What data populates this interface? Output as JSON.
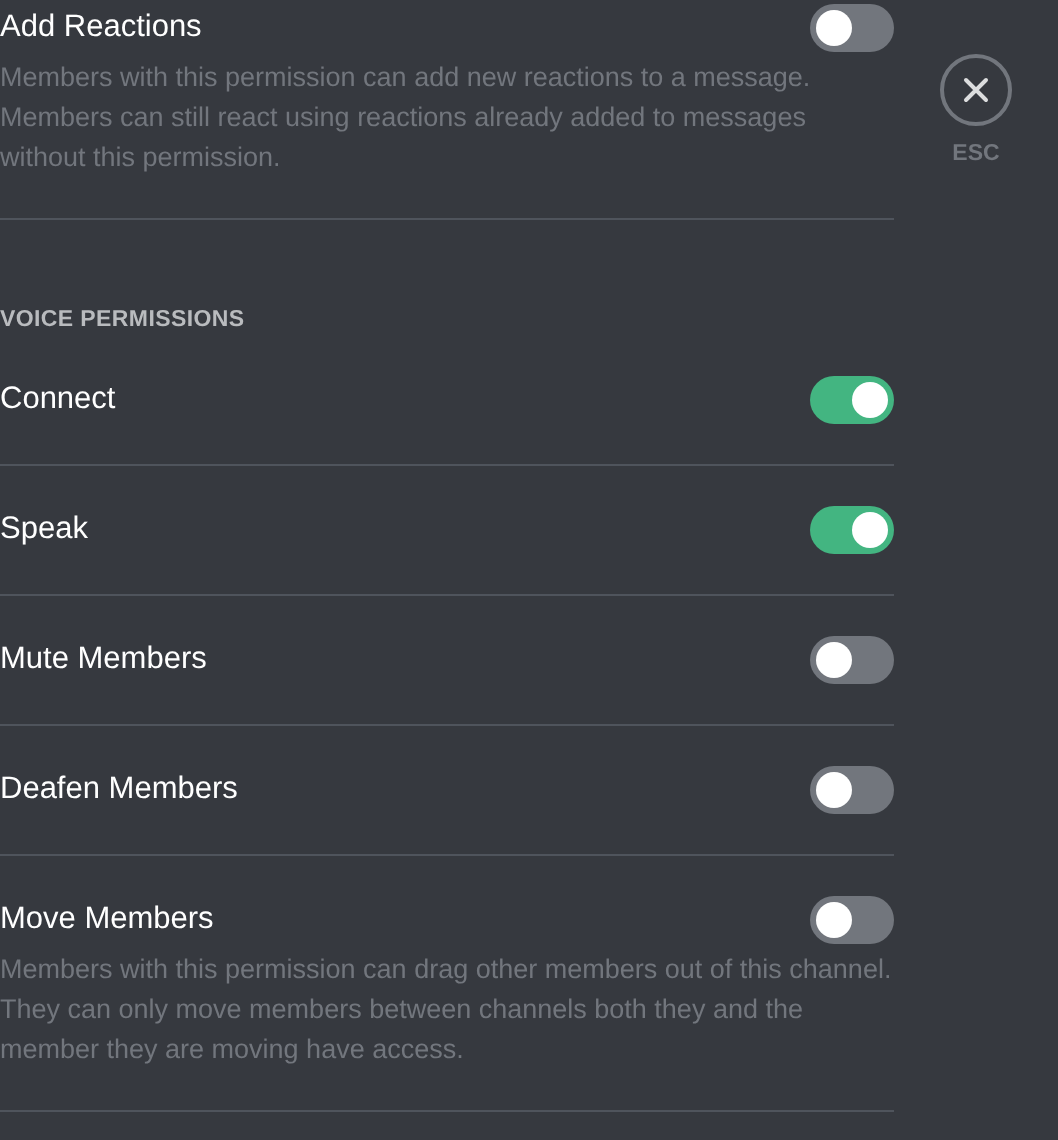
{
  "sections": [
    {
      "items": [
        {
          "title": "Add Reactions",
          "description": "Members with this permission can add new reactions to a message. Members can still react using reactions already added to messages without this permission.",
          "on": false
        }
      ]
    },
    {
      "header": "VOICE PERMISSIONS",
      "items": [
        {
          "title": "Connect",
          "on": true
        },
        {
          "title": "Speak",
          "on": true
        },
        {
          "title": "Mute Members",
          "on": false
        },
        {
          "title": "Deafen Members",
          "on": false
        },
        {
          "title": "Move Members",
          "description": "Members with this permission can drag other members out of this channel. They can only move members between channels both they and the member they are moving have access.",
          "on": false
        }
      ]
    }
  ],
  "close": {
    "label": "ESC"
  }
}
